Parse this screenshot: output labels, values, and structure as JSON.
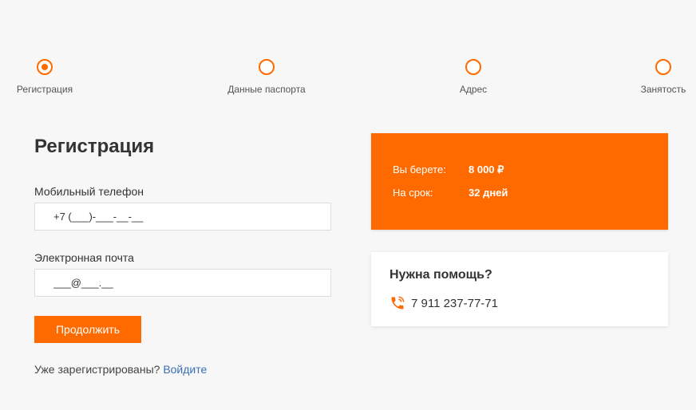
{
  "colors": {
    "accent": "#ff6a00",
    "link": "#3b6fb6",
    "background": "#f7f7f7",
    "text": "#333333"
  },
  "steps": [
    {
      "label": "Регистрация",
      "active": true
    },
    {
      "label": "Данные паспорта",
      "active": false
    },
    {
      "label": "Адрес",
      "active": false
    },
    {
      "label": "Занятость",
      "active": false
    }
  ],
  "form": {
    "title": "Регистрация",
    "phone": {
      "label": "Мобильный телефон",
      "placeholder": "+7 (___)-___-__-__",
      "value": ""
    },
    "email": {
      "label": "Электронная почта",
      "placeholder": "___@___.__",
      "value": ""
    },
    "submit_label": "Продолжить",
    "login_prompt": "Уже зарегистрированы?",
    "login_link": "Войдите"
  },
  "loan_summary": {
    "amount_label": "Вы берете:",
    "amount_value": "8 000 ₽",
    "term_label": "На срок:",
    "term_value": "32 дней"
  },
  "help": {
    "title": "Нужна помощь?",
    "phone_icon": "phone-call-icon",
    "phone": "7 911 237-77-71"
  }
}
